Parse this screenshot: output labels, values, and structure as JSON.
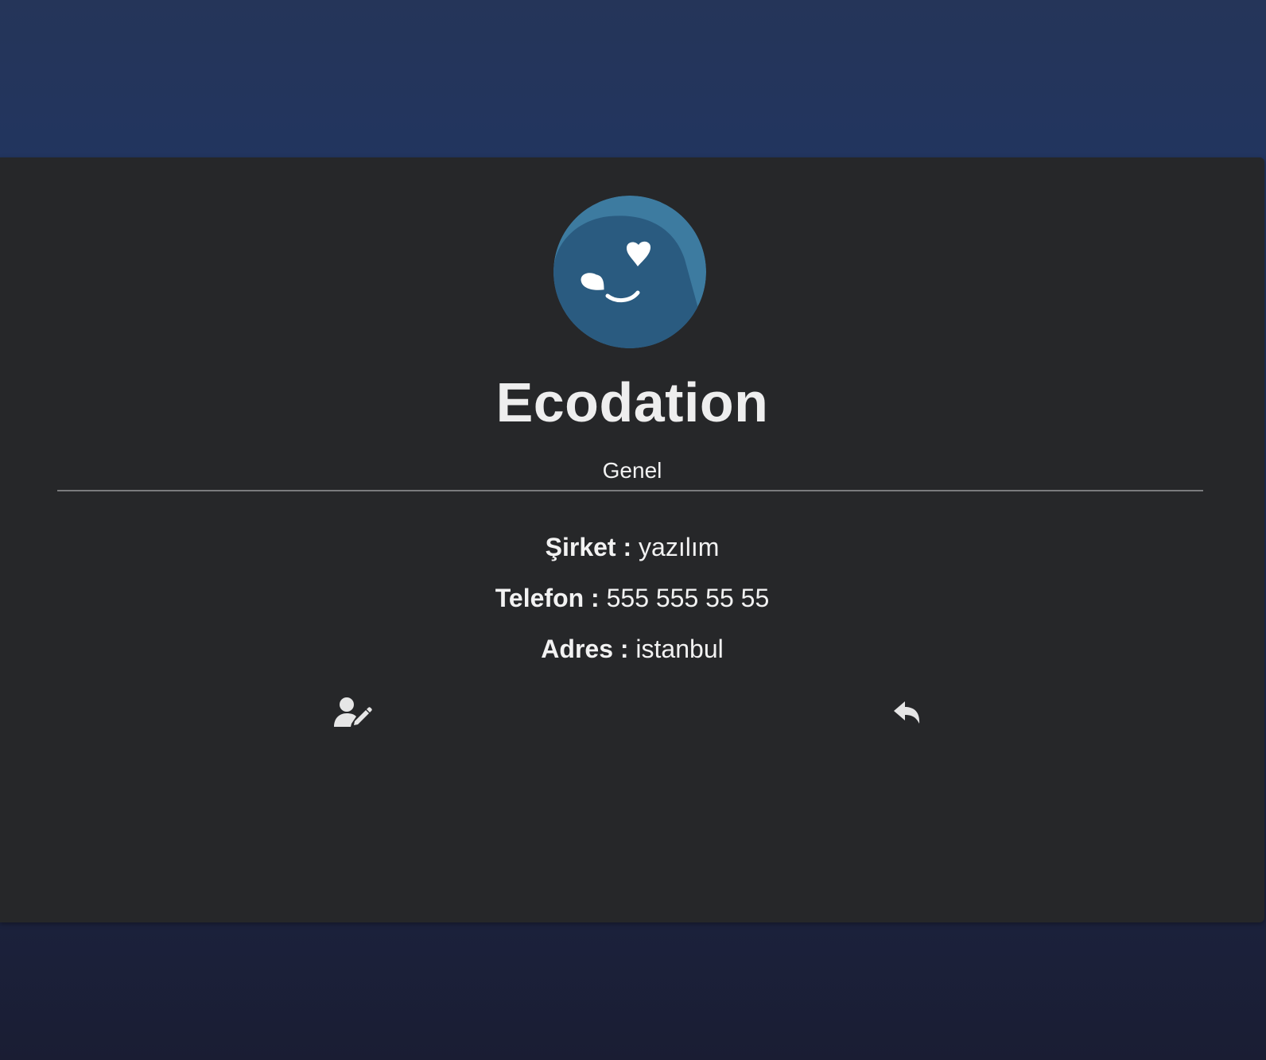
{
  "profile": {
    "name": "Ecodation",
    "category": "Genel",
    "avatar_icon": "heart-eyes-smiley-icon"
  },
  "details": {
    "company_label": "Şirket",
    "company_value": "yazılım",
    "phone_label": "Telefon",
    "phone_value": "555 555 55 55",
    "address_label": "Adres",
    "address_value": "istanbul",
    "separator": ":"
  },
  "actions": {
    "edit_icon": "user-edit-icon",
    "back_icon": "reply-arrow-icon"
  },
  "colors": {
    "background_top": "#253559",
    "background_bottom": "#1a1d33",
    "card": "#262729",
    "avatar_fill": "#2a5b80",
    "avatar_highlight": "#3d7ba0",
    "text": "#eeeeee"
  }
}
